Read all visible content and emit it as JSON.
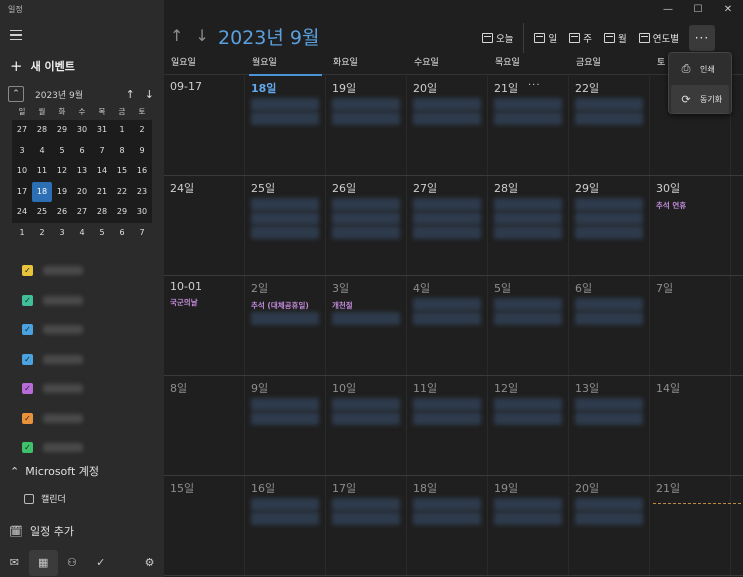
{
  "app_title": "일정",
  "sidebar": {
    "new_event": "새 이벤트",
    "mini_month": "2023년 9월",
    "weekdays": [
      "일",
      "월",
      "화",
      "수",
      "목",
      "금",
      "토"
    ],
    "weeks": [
      [
        "27",
        "28",
        "29",
        "30",
        "31",
        "1",
        "2"
      ],
      [
        "3",
        "4",
        "5",
        "6",
        "7",
        "8",
        "9"
      ],
      [
        "10",
        "11",
        "12",
        "13",
        "14",
        "15",
        "16"
      ],
      [
        "17",
        "18",
        "19",
        "20",
        "21",
        "22",
        "23"
      ],
      [
        "24",
        "25",
        "26",
        "27",
        "28",
        "29",
        "30"
      ],
      [
        "1",
        "2",
        "3",
        "4",
        "5",
        "6",
        "7"
      ]
    ],
    "calendar_colors": [
      "#e8c33c",
      "#3fc09a",
      "#4aa3e0",
      "#4aa3e0",
      "#b76ad8",
      "#e9923c",
      "#3fc06a"
    ],
    "account": "Microsoft 계정",
    "calendar_entry": "캘린더",
    "add_calendar": "일정 추가"
  },
  "header": {
    "month_title": "2023년 9월",
    "today": "오늘",
    "day": "일",
    "week": "주",
    "month": "월",
    "year": "연도별"
  },
  "weekdays": [
    "일요일",
    "월요일",
    "화요일",
    "수요일",
    "목요일",
    "금요일",
    "토"
  ],
  "weeks": [
    {
      "days": [
        "09-17",
        "18일",
        "19일",
        "20일",
        "21일",
        "22일",
        ""
      ],
      "holidays": [
        "",
        "",
        "",
        "",
        "",
        "",
        ""
      ]
    },
    {
      "days": [
        "24일",
        "25일",
        "26일",
        "27일",
        "28일",
        "29일",
        "30일"
      ],
      "holidays": [
        "",
        "",
        "",
        "",
        "",
        "",
        "추석 연휴"
      ]
    },
    {
      "days": [
        "10-01",
        "2일",
        "3일",
        "4일",
        "5일",
        "6일",
        "7일"
      ],
      "holidays": [
        "국군의날",
        "추석 (대체공휴일)",
        "개천절",
        "",
        "",
        "",
        ""
      ]
    },
    {
      "days": [
        "8일",
        "9일",
        "10일",
        "11일",
        "12일",
        "13일",
        "14일"
      ],
      "holidays": [
        "",
        "",
        "",
        "",
        "",
        "",
        ""
      ]
    },
    {
      "days": [
        "15일",
        "16일",
        "17일",
        "18일",
        "19일",
        "20일",
        "21일"
      ],
      "holidays": [
        "",
        "",
        "",
        "",
        "",
        "",
        ""
      ]
    }
  ],
  "popup": {
    "print": "인쇄",
    "sync": "동기화"
  }
}
